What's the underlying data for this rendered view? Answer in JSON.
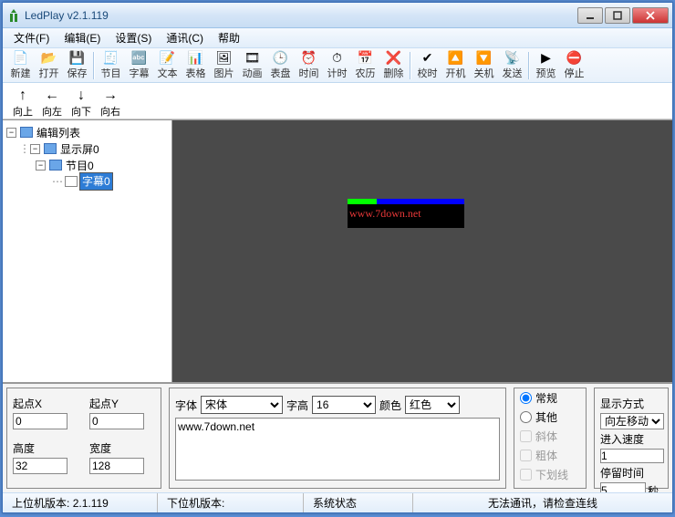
{
  "window": {
    "title": "LedPlay  v2.1.119"
  },
  "menu": [
    "文件(F)",
    "编辑(E)",
    "设置(S)",
    "通讯(C)",
    "帮助"
  ],
  "toolbar": {
    "g1": [
      {
        "name": "new",
        "icon": "📄",
        "label": "新建"
      },
      {
        "name": "open",
        "icon": "📂",
        "label": "打开"
      },
      {
        "name": "save",
        "icon": "💾",
        "label": "保存"
      }
    ],
    "g2": [
      {
        "name": "program",
        "icon": "🧾",
        "label": "节目"
      },
      {
        "name": "subtitle",
        "icon": "🔤",
        "label": "字幕"
      },
      {
        "name": "text",
        "icon": "📝",
        "label": "文本"
      },
      {
        "name": "table",
        "icon": "📊",
        "label": "表格"
      },
      {
        "name": "image",
        "icon": "🖼",
        "label": "图片"
      },
      {
        "name": "anim",
        "icon": "🎞",
        "label": "动画"
      },
      {
        "name": "dial",
        "icon": "🕒",
        "label": "表盘"
      },
      {
        "name": "time",
        "icon": "⏰",
        "label": "时间"
      },
      {
        "name": "timer",
        "icon": "⏱",
        "label": "计时"
      },
      {
        "name": "lunar",
        "icon": "📅",
        "label": "农历"
      },
      {
        "name": "delete",
        "icon": "❌",
        "label": "删除"
      }
    ],
    "g3": [
      {
        "name": "sync",
        "icon": "✔",
        "label": "校时"
      },
      {
        "name": "poweron",
        "icon": "🔼",
        "label": "开机"
      },
      {
        "name": "poweroff",
        "icon": "🔽",
        "label": "关机"
      },
      {
        "name": "send",
        "icon": "📡",
        "label": "发送"
      }
    ],
    "g4": [
      {
        "name": "preview",
        "icon": "▶",
        "label": "预览"
      },
      {
        "name": "stop",
        "icon": "⛔",
        "label": "停止"
      }
    ]
  },
  "nav": [
    {
      "name": "up",
      "arrow": "↑",
      "label": "向上"
    },
    {
      "name": "left",
      "arrow": "←",
      "label": "向左"
    },
    {
      "name": "down",
      "arrow": "↓",
      "label": "向下"
    },
    {
      "name": "right",
      "arrow": "→",
      "label": "向右"
    }
  ],
  "tree": {
    "root": "编辑列表",
    "screen": "显示屏0",
    "program": "节目0",
    "subtitle": "字幕0"
  },
  "preview_text": "www.7down.net",
  "coords": {
    "x_label": "起点X",
    "x": "0",
    "y_label": "起点Y",
    "y": "0",
    "h_label": "高度",
    "h": "32",
    "w_label": "宽度",
    "w": "128"
  },
  "textpanel": {
    "font_label": "字体",
    "font": "宋体",
    "size_label": "字高",
    "size": "16",
    "color_label": "颜色",
    "color": "红色",
    "content": "www.7down.net"
  },
  "style": {
    "normal": "常规",
    "other": "其他",
    "italic": "斜体",
    "bold": "粗体",
    "underline": "下划线"
  },
  "display": {
    "mode_label": "显示方式",
    "mode": "向左移动(连",
    "speed_label": "进入速度",
    "speed": "1",
    "stay_label": "停留时间",
    "stay": "5",
    "stay_unit": "秒"
  },
  "status": {
    "host_label": "上位机版本:",
    "host": "2.1.119",
    "dev_label": "下位机版本:",
    "dev": "",
    "state_label": "系统状态",
    "state": "",
    "comm": "无法通讯，请检查连线"
  }
}
